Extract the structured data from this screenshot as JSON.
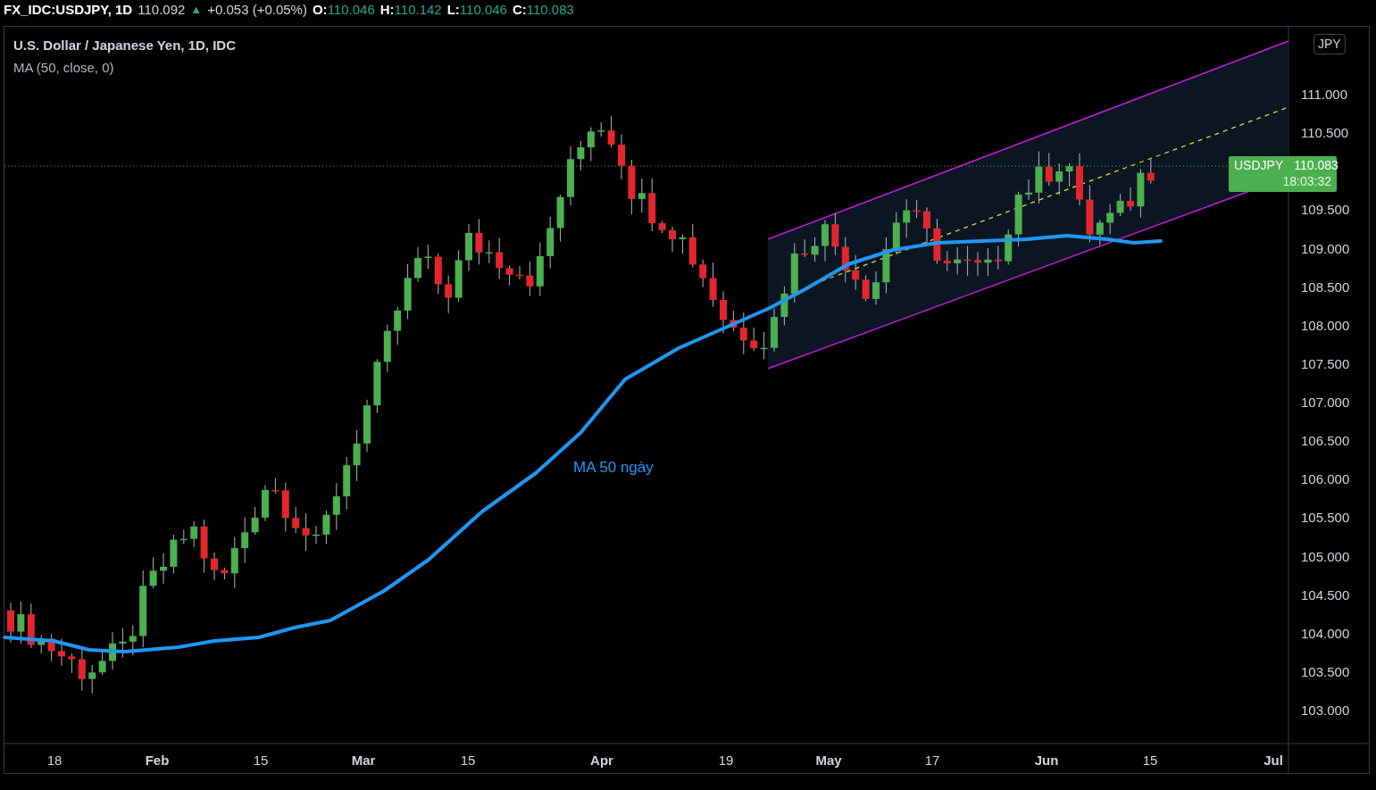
{
  "header": {
    "symbol": "FX_IDC:USDJPY, 1D",
    "last": "110.092",
    "change_icon": "▲",
    "change": "+0.053 (+0.05%)",
    "ohlc": [
      {
        "label": "O:",
        "value": "110.046"
      },
      {
        "label": "H:",
        "value": "110.142"
      },
      {
        "label": "L:",
        "value": "110.046"
      },
      {
        "label": "C:",
        "value": "110.083"
      }
    ]
  },
  "legend": {
    "title": "U.S. Dollar / Japanese Yen, 1D, IDC",
    "indicator": "MA (50, close, 0)"
  },
  "annotation": "MA 50 ngày",
  "currency": "JPY",
  "price_axis": [
    "111.000",
    "110.500",
    "109.500",
    "109.000",
    "108.500",
    "108.000",
    "107.500",
    "107.000",
    "106.500",
    "106.000",
    "105.500",
    "105.000",
    "104.500",
    "104.000",
    "103.500",
    "103.000"
  ],
  "price_label": {
    "symbol": "USDJPY",
    "value": "110.083",
    "countdown": "18:03:32"
  },
  "time_axis": [
    {
      "label": "18",
      "kind": "day"
    },
    {
      "label": "Feb",
      "kind": "month"
    },
    {
      "label": "15",
      "kind": "day"
    },
    {
      "label": "Mar",
      "kind": "month"
    },
    {
      "label": "15",
      "kind": "day"
    },
    {
      "label": "Apr",
      "kind": "month"
    },
    {
      "label": "19",
      "kind": "day"
    },
    {
      "label": "May",
      "kind": "month"
    },
    {
      "label": "17",
      "kind": "day"
    },
    {
      "label": "Jun",
      "kind": "month"
    },
    {
      "label": "15",
      "kind": "day"
    },
    {
      "label": "Jul",
      "kind": "month"
    }
  ]
}
